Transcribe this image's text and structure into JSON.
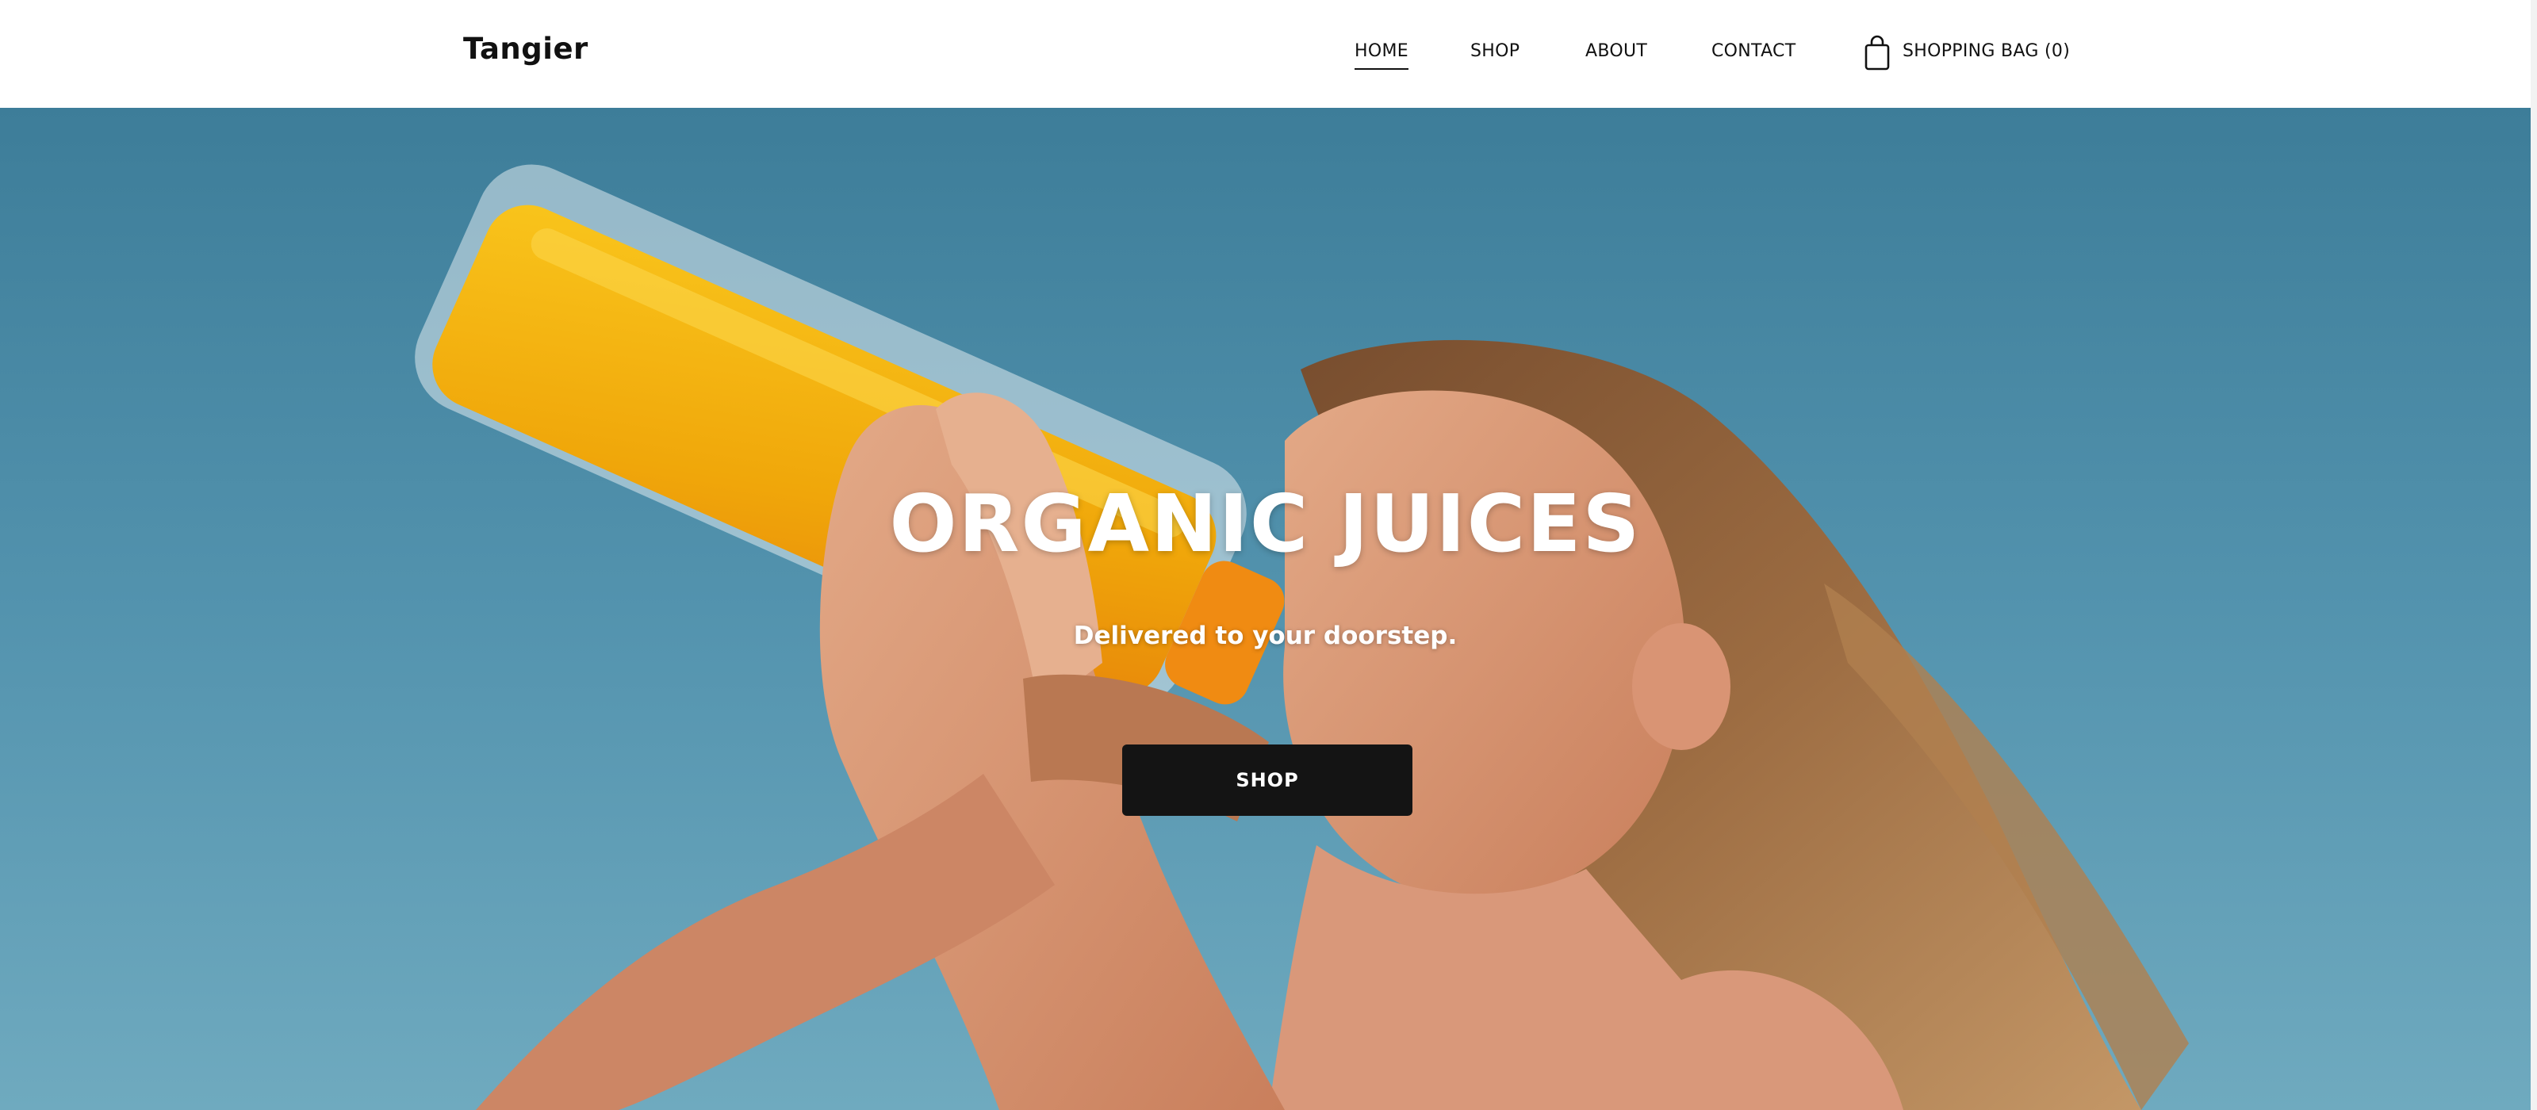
{
  "header": {
    "logo": "Tangier",
    "nav": [
      {
        "label": "HOME",
        "active": true
      },
      {
        "label": "SHOP"
      },
      {
        "label": "ABOUT"
      },
      {
        "label": "CONTACT"
      }
    ],
    "bag": {
      "icon": "shopping-bag-icon",
      "label": "SHOPPING BAG (0)"
    }
  },
  "hero": {
    "title": "ORGANIC JUICES",
    "subtitle": "Delivered to your doorstep.",
    "button_label": "SHOP",
    "image": "girl-drinking-orange-juice-photo"
  },
  "colors": {
    "header_bg": "#ffffff",
    "text_dark": "#111111",
    "sky_blue": "#4b8aa6",
    "juice_orange": "#f3b20f",
    "button_bg": "#141414",
    "button_text": "#ffffff"
  }
}
